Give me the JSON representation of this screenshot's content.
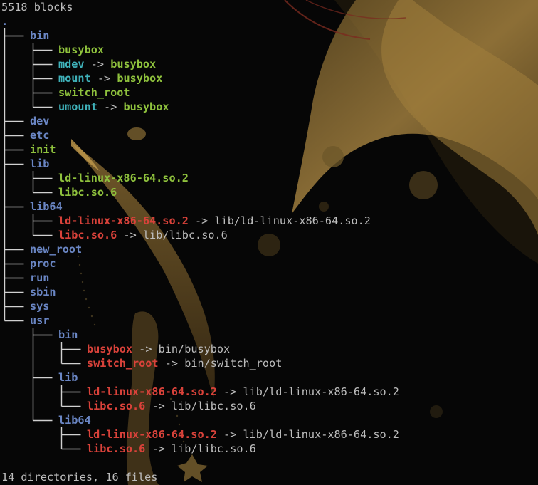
{
  "terminal": {
    "header": "5518 blocks",
    "root": ".",
    "summary": "14 directories, 16 files",
    "colors": {
      "background": "#060606",
      "directory": "#6a86c4",
      "executable": "#8fc23d",
      "symlink": "#3fb1b9",
      "broken_symlink": "#d9423a",
      "text": "#bdbdbd",
      "tree_lines": "#d0d0d0"
    }
  },
  "tree": [
    {
      "depth": 0,
      "last": false,
      "name": "bin",
      "type": "dir"
    },
    {
      "depth": 1,
      "last": false,
      "name": "busybox",
      "type": "exec"
    },
    {
      "depth": 1,
      "last": false,
      "name": "mdev",
      "type": "link",
      "arrow": "->",
      "target": "busybox",
      "target_type": "exec"
    },
    {
      "depth": 1,
      "last": false,
      "name": "mount",
      "type": "link",
      "arrow": "->",
      "target": "busybox",
      "target_type": "exec"
    },
    {
      "depth": 1,
      "last": false,
      "name": "switch_root",
      "type": "exec"
    },
    {
      "depth": 1,
      "last": true,
      "name": "umount",
      "type": "link",
      "arrow": "->",
      "target": "busybox",
      "target_type": "exec"
    },
    {
      "depth": 0,
      "last": false,
      "name": "dev",
      "type": "dir"
    },
    {
      "depth": 0,
      "last": false,
      "name": "etc",
      "type": "dir"
    },
    {
      "depth": 0,
      "last": false,
      "name": "init",
      "type": "exec"
    },
    {
      "depth": 0,
      "last": false,
      "name": "lib",
      "type": "dir"
    },
    {
      "depth": 1,
      "last": false,
      "name": "ld-linux-x86-64.so.2",
      "type": "exec"
    },
    {
      "depth": 1,
      "last": true,
      "name": "libc.so.6",
      "type": "exec"
    },
    {
      "depth": 0,
      "last": false,
      "name": "lib64",
      "type": "dir"
    },
    {
      "depth": 1,
      "last": false,
      "name": "ld-linux-x86-64.so.2",
      "type": "broken",
      "arrow": "->",
      "target": "lib/ld-linux-x86-64.so.2",
      "target_type": "plain"
    },
    {
      "depth": 1,
      "last": true,
      "name": "libc.so.6",
      "type": "broken",
      "arrow": "->",
      "target": "lib/libc.so.6",
      "target_type": "plain"
    },
    {
      "depth": 0,
      "last": false,
      "name": "new_root",
      "type": "dir"
    },
    {
      "depth": 0,
      "last": false,
      "name": "proc",
      "type": "dir"
    },
    {
      "depth": 0,
      "last": false,
      "name": "run",
      "type": "dir"
    },
    {
      "depth": 0,
      "last": false,
      "name": "sbin",
      "type": "dir"
    },
    {
      "depth": 0,
      "last": false,
      "name": "sys",
      "type": "dir"
    },
    {
      "depth": 0,
      "last": true,
      "name": "usr",
      "type": "dir"
    },
    {
      "depth": 1,
      "last": false,
      "name": "bin",
      "type": "dir"
    },
    {
      "depth": 2,
      "last": false,
      "name": "busybox",
      "type": "broken",
      "arrow": "->",
      "target": "bin/busybox",
      "target_type": "plain"
    },
    {
      "depth": 2,
      "last": true,
      "name": "switch_root",
      "type": "broken",
      "arrow": "->",
      "target": "bin/switch_root",
      "target_type": "plain"
    },
    {
      "depth": 1,
      "last": false,
      "name": "lib",
      "type": "dir"
    },
    {
      "depth": 2,
      "last": false,
      "name": "ld-linux-x86-64.so.2",
      "type": "broken",
      "arrow": "->",
      "target": "lib/ld-linux-x86-64.so.2",
      "target_type": "plain"
    },
    {
      "depth": 2,
      "last": true,
      "name": "libc.so.6",
      "type": "broken",
      "arrow": "->",
      "target": "lib/libc.so.6",
      "target_type": "plain"
    },
    {
      "depth": 1,
      "last": true,
      "name": "lib64",
      "type": "dir"
    },
    {
      "depth": 2,
      "last": false,
      "name": "ld-linux-x86-64.so.2",
      "type": "broken",
      "arrow": "->",
      "target": "lib/ld-linux-x86-64.so.2",
      "target_type": "plain"
    },
    {
      "depth": 2,
      "last": true,
      "name": "libc.so.6",
      "type": "broken",
      "arrow": "->",
      "target": "lib/libc.so.6",
      "target_type": "plain"
    }
  ]
}
